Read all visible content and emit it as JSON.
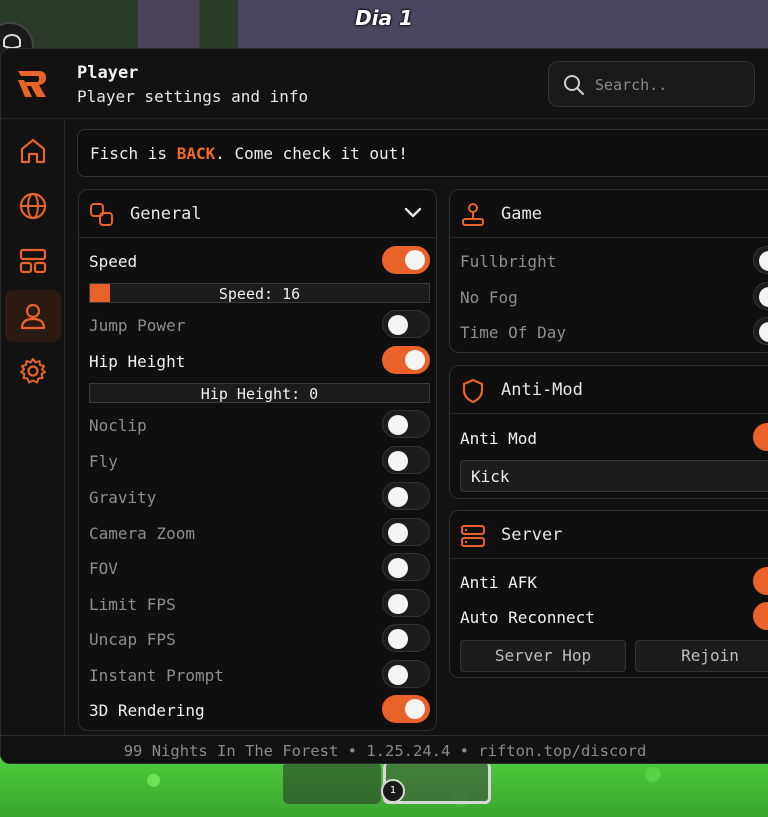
{
  "game": {
    "day_label": "Dia 1",
    "hotbar_slot_number": "1"
  },
  "colors": {
    "accent": "#e8622a",
    "panel_bg": "#121212"
  },
  "header": {
    "title": "Player",
    "subtitle": "Player settings and info",
    "search_placeholder": "Search.."
  },
  "sidebar": {
    "items": [
      {
        "icon": "home-icon",
        "active": false
      },
      {
        "icon": "globe-icon",
        "active": false
      },
      {
        "icon": "layout-icon",
        "active": false
      },
      {
        "icon": "user-icon",
        "active": true
      },
      {
        "icon": "gear-icon",
        "active": false
      }
    ]
  },
  "announcement": {
    "prefix": "Fisch is ",
    "highlight": "BACK",
    "suffix": ". Come check it out!"
  },
  "general": {
    "title": "General",
    "speed_label": "Speed",
    "speed_slider_text": "Speed: 16",
    "speed_slider_fill": 0.06,
    "jump_power_label": "Jump Power",
    "hip_height_label": "Hip Height",
    "hip_height_slider_text": "Hip Height: 0",
    "hip_height_slider_fill": 0,
    "noclip_label": "Noclip",
    "fly_label": "Fly",
    "gravity_label": "Gravity",
    "camera_zoom_label": "Camera Zoom",
    "fov_label": "FOV",
    "limit_fps_label": "Limit FPS",
    "uncap_fps_label": "Uncap FPS",
    "instant_prompt_label": "Instant Prompt",
    "rendering_3d_label": "3D Rendering",
    "states": {
      "speed": true,
      "jump_power": false,
      "hip_height": true,
      "noclip": false,
      "fly": false,
      "gravity": false,
      "camera_zoom": false,
      "fov": false,
      "limit_fps": false,
      "uncap_fps": false,
      "instant_prompt": false,
      "rendering_3d": true
    }
  },
  "game_card": {
    "title": "Game",
    "fullbright_label": "Fullbright",
    "no_fog_label": "No Fog",
    "time_of_day_label": "Time Of Day"
  },
  "anti_mod": {
    "title": "Anti-Mod",
    "anti_mod_label": "Anti Mod",
    "action_value": "Kick"
  },
  "server": {
    "title": "Server",
    "anti_afk_label": "Anti AFK",
    "auto_reconnect_label": "Auto Reconnect",
    "server_hop_label": "Server Hop",
    "rejoin_label": "Rejoin"
  },
  "footer": {
    "text": "99 Nights In The Forest • 1.25.24.4 • rifton.top/discord"
  }
}
